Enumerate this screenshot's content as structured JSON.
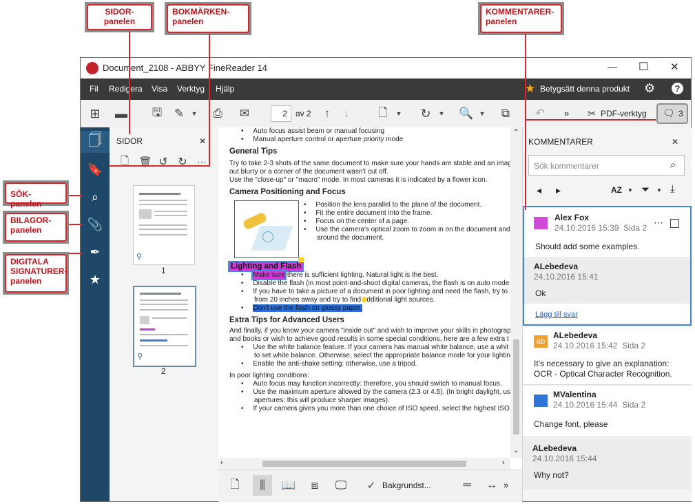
{
  "callouts": {
    "sidor": "SIDOR-\npanelen",
    "bokmarken": "BOKMÄRKEN-\npanelen",
    "kommentarer": "KOMMENTARER-\npanelen",
    "sok": "SÖK-panelen",
    "bilagor": "BILAGOR-\npanelen",
    "digitala": "DIGITALA\nSIGNATURER-\npanelen"
  },
  "window": {
    "title": "Document_2108 - ABBYY FineReader 14",
    "minimize": "—",
    "maximize": "☐",
    "close": "✕"
  },
  "menu": {
    "items": [
      "Fil",
      "Redigera",
      "Visa",
      "Verktyg",
      "Hjälp"
    ],
    "rate": "Betygsätt denna produkt"
  },
  "toolbar": {
    "page_value": "2",
    "page_of": "av 2",
    "pdf_tools": "PDF-verktyg",
    "comment_count": "3",
    "more": "»"
  },
  "pages_panel": {
    "title": "SIDOR",
    "close": "✕",
    "thumb1": "1",
    "thumb2": "2"
  },
  "document": {
    "bullets_top": [
      "Auto focus assist beam or manual focusing",
      "Manual aperture control or aperture priority mode"
    ],
    "h_general": "General Tips",
    "general_p1": "Try to take 2-3 shots of the same document to make sure your hands are stable and an imag",
    "general_p2": "out blurry or a corner of the document wasn't cut off.",
    "general_p3": "Use the \"close-up\" or \"macro\" mode. In most cameras it is indicated by a flower icon.",
    "h_camera": "Camera Positioning and Focus",
    "camera_bullets": [
      "Position the lens parallel to the plane of the document.",
      "Fit the entire document into the frame.",
      "Focus on the center of a page.",
      "Use the camera's optical zoom to zoom in on the document and",
      "around the document."
    ],
    "h_lighting": "Lighting and Flash",
    "lighting_b1a": "Make sure",
    "lighting_b1b": " there is sufficient lighting. Natural light is the best.",
    "lighting_b2": "Disable the flash (in most point-and-shoot digital cameras, the flash is on auto mode",
    "lighting_b3": "If you have to take a picture of a document in poor lighting and need the flash, try to",
    "lighting_b3b": "from 20 inches away and try to find additional light sources.",
    "lighting_b4": "Don't use the flash on glossy paper.",
    "h_extra": "Extra Tips for Advanced Users",
    "extra_p1": "And finally, if you know your camera \"inside out\" and wish to improve your skills in photograp",
    "extra_p2": "and books or wish to achieve good results in some special conditions, here are a few extra t",
    "extra_b1": "Use the white balance feature. If your camera has manual white balance, use a whit",
    "extra_b1b": "to set white balance. Otherwise, select the appropriate balance mode for your lightin",
    "extra_b2": "Enable the anti-shake setting: otherwise, use a tripod.",
    "poor": "In poor lighting conditions:",
    "poor_b1": "Auto focus may function incorrectly: therefore, you should switch to manual focus.",
    "poor_b2": "Use the maximum aperture allowed by the camera (2.3 or 4.5). (In bright daylight, us",
    "poor_b2b": "apertures: this will produce sharper images).",
    "poor_b3": "If your camera gives you more than one choice of ISO speed, select the highest ISO"
  },
  "bottom": {
    "background": "Bakgrundst...",
    "more": "»"
  },
  "comments_panel": {
    "title": "KOMMENTARER",
    "close": "✕",
    "search_placeholder": "Sök kommentarer",
    "sort": "AZ",
    "items": [
      {
        "author": "Alex Fox",
        "meta": "24.10.2016 15:39  Sida 2",
        "text": "Should add some examples.",
        "color": "#d24ad8"
      },
      {
        "author": "ALebedeva",
        "meta": "24.10.2016 15:41",
        "text": "Ok"
      },
      {
        "author": "ALebedeva",
        "meta": "24.10.2016 15:42  Sida 2",
        "text": "It's necessary to give an explanation: OCR - Optical Character Recognition.",
        "badge": "ab",
        "color": "#f0a030"
      },
      {
        "author": "MValentina",
        "meta": "24.10.2016 15:44  Sida 2",
        "text": "Change font, please",
        "color": "#2f74d8"
      },
      {
        "author": "ALebedeva",
        "meta": "24.10.2016 15:44",
        "text": "Why not?"
      }
    ],
    "reply": "Lägg till svar"
  },
  "colors": {
    "menubar": "#3a3a3a",
    "sidebar": "#1f4868",
    "accent": "#2f74c8",
    "callout_red": "#d6262e"
  }
}
